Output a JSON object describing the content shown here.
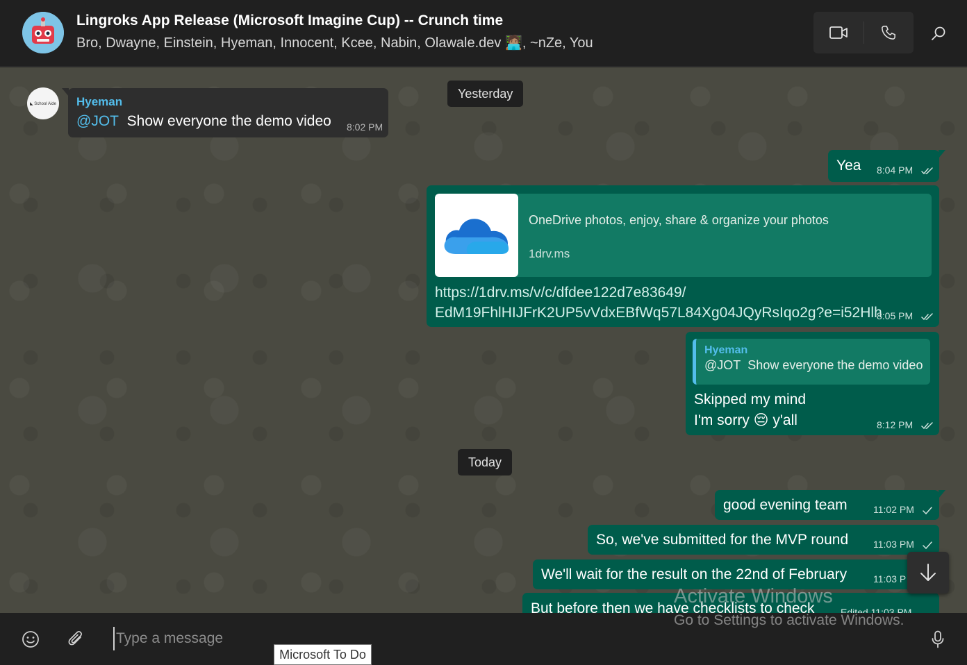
{
  "header": {
    "title": "Lingroks App Release (Microsoft Imagine Cup) -- Crunch time",
    "members_before": "Bro, Dwayne, Einstein, Hyeman, Innocent, Kcee, Nabin, Olawale.dev",
    "members_emoji": "🧑🏽‍💻",
    "members_after": ", ~nZe, You",
    "icons": [
      "video-call-icon",
      "voice-call-icon",
      "search-icon"
    ]
  },
  "messages": {
    "date_yesterday": "Yesterday",
    "date_today": "Today",
    "m1": {
      "sender": "Hyeman",
      "mention": "@JOT",
      "text": "Show everyone the demo video",
      "time": "8:02 PM"
    },
    "m2": {
      "text": "Yea",
      "time": "8:04 PM"
    },
    "m3": {
      "link_title": "OneDrive photos, enjoy, share & organize your photos",
      "link_domain": "1drv.ms",
      "url_line1": "https://1drv.ms/v/c/dfdee122d7e83649/",
      "url_line2": "EdM19FhlHIJFrK2UP5vVdxEBfWq57L84Xg04JQyRsIqo2g?e=i52Hlh",
      "time": "8:05 PM"
    },
    "m4": {
      "quote_sender": "Hyeman",
      "quote_mention": "@JOT",
      "quote_text": "Show everyone the demo video",
      "line1": "Skipped my mind",
      "line2_before": "I'm sorry ",
      "emoji": "😔",
      "line2_after": " y'all",
      "time": "8:12 PM"
    },
    "m5": {
      "text": "good evening team",
      "time": "11:02 PM"
    },
    "m6": {
      "text": "So, we've submitted for the MVP round",
      "time": "11:03 PM"
    },
    "m7": {
      "text": "We'll wait for the result on the 22nd of February",
      "time": "11:03 P"
    },
    "m8": {
      "text": "But before then we have checklists to check",
      "time": "Edited 11:03 PM"
    }
  },
  "input": {
    "placeholder": "Type a message"
  },
  "tooltip": "Microsoft To Do",
  "watermark": {
    "line1": "Activate Windows",
    "line2": "Go to Settings to activate Windows."
  },
  "colors": {
    "outgoing_bubble": "#005c4b",
    "incoming_bubble": "#2e2e2e",
    "accent_blue": "#53bdeb",
    "chat_background": "#4a4a41"
  }
}
